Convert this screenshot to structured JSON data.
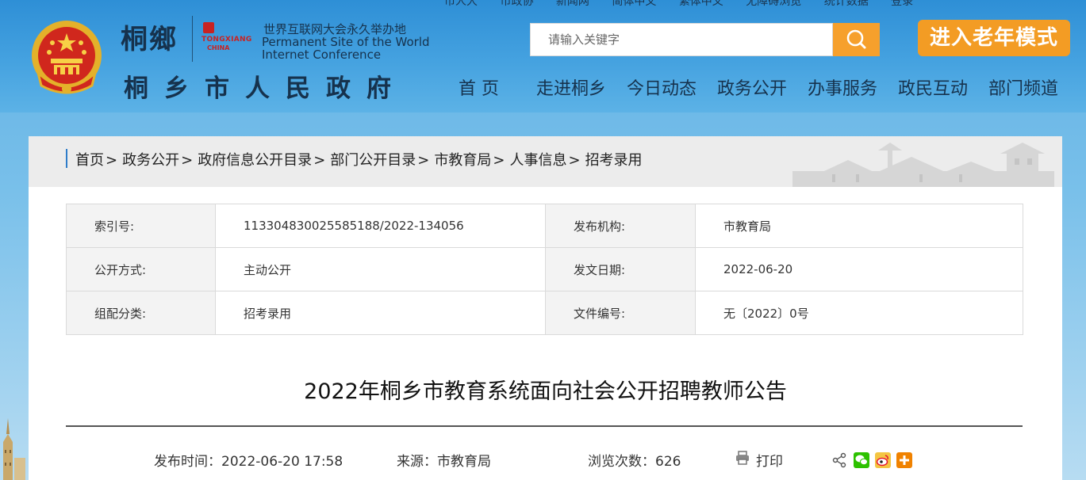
{
  "top_links": [
    "市人大",
    "市政协",
    "新闻网",
    "简体中文",
    "繁体中文",
    "无障碍浏览",
    "统计数据",
    "登录"
  ],
  "logo": {
    "script": "桐鄉",
    "en_top": "TONGXIANG",
    "en_bottom": "CHINA",
    "wic_cn": "世界互联网大会永久举办地",
    "wic_en_1": "Permanent Site of the World",
    "wic_en_2": "Internet Conference",
    "site_title": "桐乡市人民政府"
  },
  "search": {
    "placeholder": "请输入关键字",
    "icon": "search-icon"
  },
  "elder_mode_label": "进入老年模式",
  "nav": [
    "首 页",
    "走进桐乡",
    "今日动态",
    "政务公开",
    "办事服务",
    "政民互动",
    "部门频道"
  ],
  "breadcrumb": [
    "首页",
    "政务公开",
    "政府信息公开目录",
    "部门公开目录",
    "市教育局",
    "人事信息",
    "招考录用"
  ],
  "breadcrumb_sep": ">",
  "meta": {
    "index_label": "索引号:",
    "index_value": "113304830025585188/2022-134056",
    "publisher_label": "发布机构:",
    "publisher_value": "市教育局",
    "open_label": "公开方式:",
    "open_value": "主动公开",
    "date_label": "发文日期:",
    "date_value": "2022-06-20",
    "category_label": "组配分类:",
    "category_value": "招考录用",
    "docno_label": "文件编号:",
    "docno_value": "无〔2022〕0号"
  },
  "article": {
    "title": "2022年桐乡市教育系统面向社会公开招聘教师公告",
    "publish_time": "发布时间：2022-06-20  17:58",
    "source": "来源：市教育局",
    "views": "浏览次数：626",
    "print_label": "打印"
  },
  "colors": {
    "accent_orange": "#f39c24",
    "nav_text": "#16324d",
    "wechat": "#2dc100",
    "weibo": "#e6162d",
    "more": "#f08200"
  }
}
